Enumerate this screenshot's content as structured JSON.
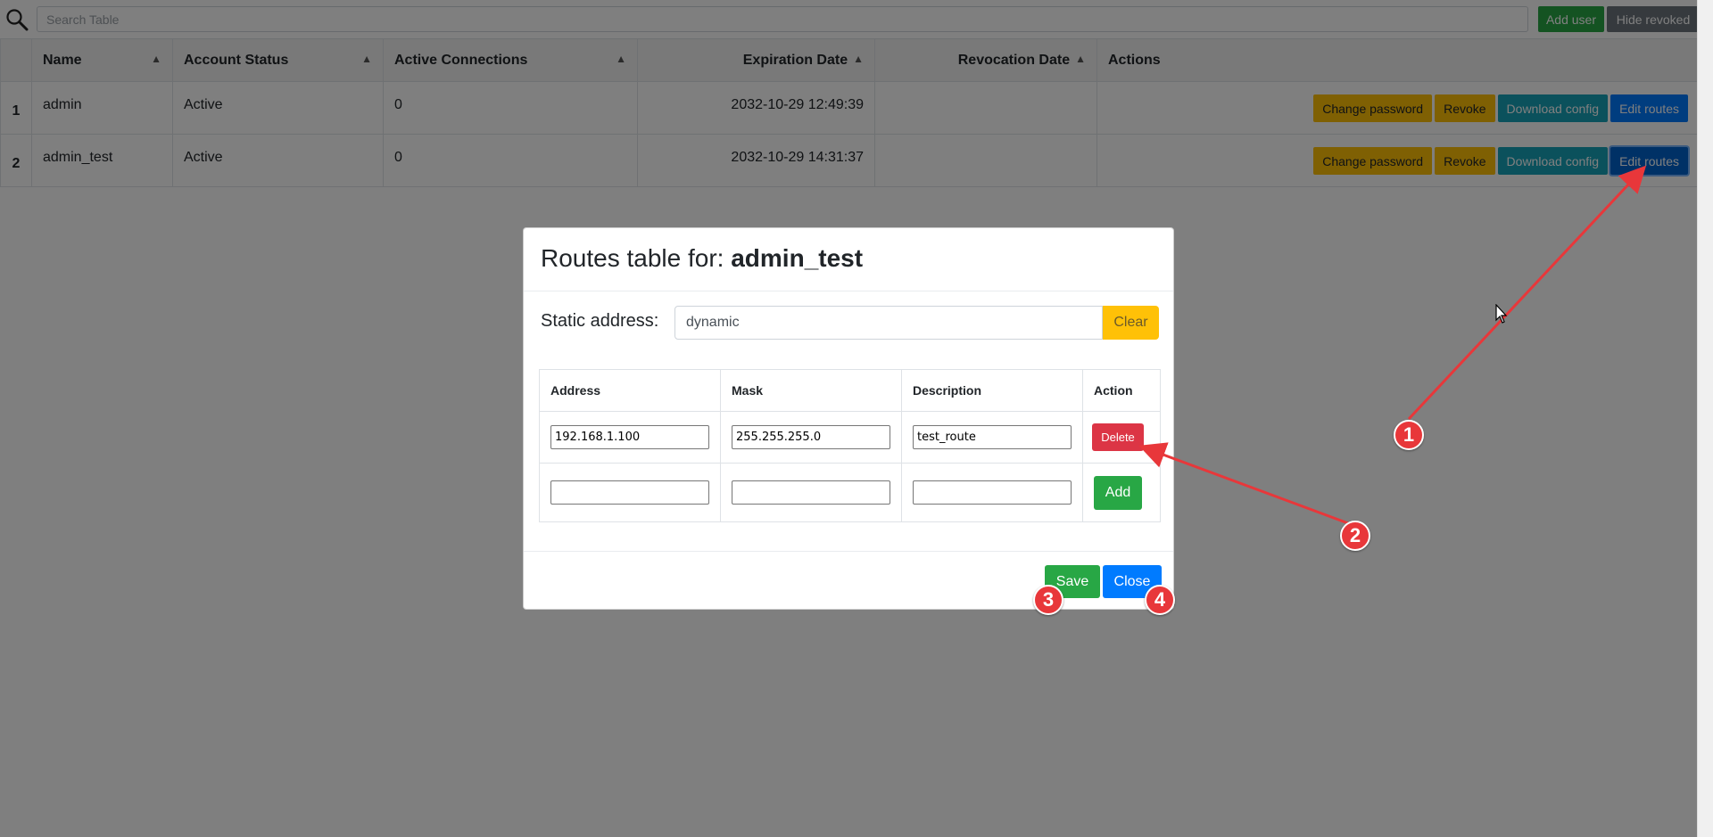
{
  "toolbar": {
    "search_placeholder": "Search Table",
    "add_user_label": "Add user",
    "hide_revoked_label": "Hide revoked"
  },
  "users_table": {
    "columns": [
      "Name",
      "Account Status",
      "Active Connections",
      "Expiration Date",
      "Revocation Date",
      "Actions"
    ],
    "rows": [
      {
        "num": "1",
        "name": "admin",
        "status": "Active",
        "connections": "0",
        "expiration": "2032-10-29 12:49:39",
        "revocation": ""
      },
      {
        "num": "2",
        "name": "admin_test",
        "status": "Active",
        "connections": "0",
        "expiration": "2032-10-29 14:31:37",
        "revocation": ""
      }
    ],
    "action_labels": {
      "change_password": "Change password",
      "revoke": "Revoke",
      "download_config": "Download config",
      "edit_routes": "Edit routes"
    }
  },
  "modal": {
    "title_prefix": "Routes table for:",
    "title_user": "admin_test",
    "static_label": "Static address:",
    "static_value": "dynamic",
    "clear_label": "Clear",
    "columns": [
      "Address",
      "Mask",
      "Description",
      "Action"
    ],
    "routes": [
      {
        "address": "192.168.1.100",
        "mask": "255.255.255.0",
        "description": "test_route"
      }
    ],
    "new_route": {
      "address": "",
      "mask": "",
      "description": ""
    },
    "delete_label": "Delete",
    "add_label": "Add",
    "save_label": "Save",
    "close_label": "Close"
  },
  "annotations": {
    "markers": [
      "1",
      "2",
      "3",
      "4"
    ],
    "color": "#e8373a"
  },
  "colors": {
    "success": "#28a745",
    "primary": "#007bff",
    "warning": "#ffc107",
    "info": "#17a2b8",
    "danger": "#dc3545",
    "secondary": "#6c757d"
  }
}
